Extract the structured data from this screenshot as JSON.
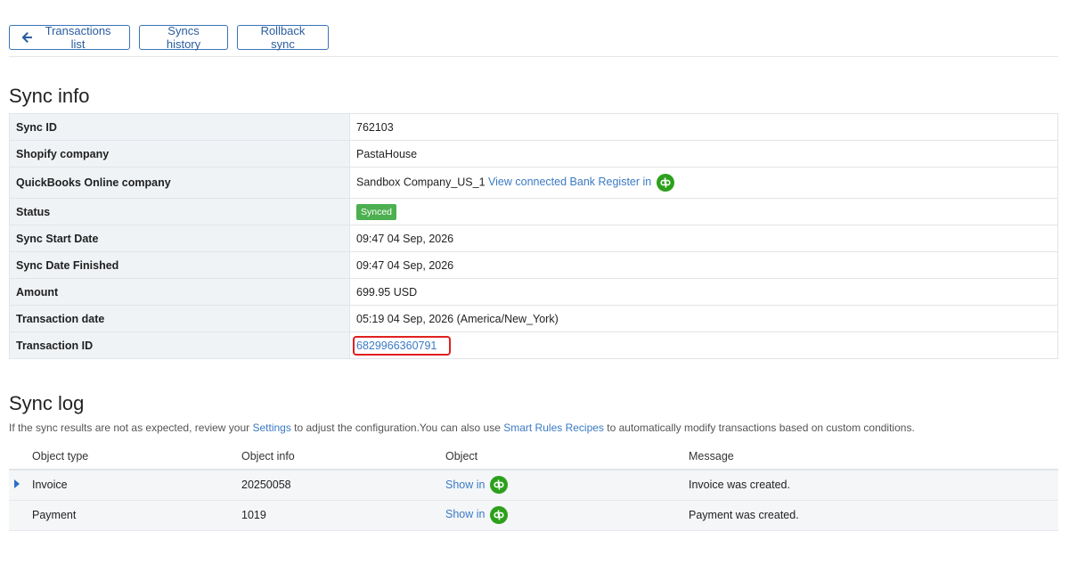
{
  "toolbar": {
    "back_label": "Transactions list",
    "history_label": "Syncs history",
    "rollback_label": "Rollback sync"
  },
  "sync_info": {
    "title": "Sync info",
    "rows": {
      "sync_id": {
        "label": "Sync ID",
        "value": "762103"
      },
      "shopify_company": {
        "label": "Shopify company",
        "value": "PastaHouse"
      },
      "qbo_company": {
        "label": "QuickBooks Online company",
        "value": "Sandbox Company_US_1",
        "link": "View connected Bank Register in"
      },
      "status": {
        "label": "Status",
        "value": "Synced"
      },
      "start_date": {
        "label": "Sync Start Date",
        "value": "09:47 04 Sep, 2026"
      },
      "finish_date": {
        "label": "Sync Date Finished",
        "value": "09:47 04 Sep, 2026"
      },
      "amount": {
        "label": "Amount",
        "value": "699.95 USD"
      },
      "transaction_date": {
        "label": "Transaction date",
        "value": "05:19 04 Sep, 2026 (America/New_York)"
      },
      "transaction_id": {
        "label": "Transaction ID",
        "value": "6829966360791"
      }
    }
  },
  "sync_log": {
    "title": "Sync log",
    "hint": {
      "part1": "If the sync results are not as expected, review your ",
      "settings_link": "Settings",
      "part2": " to adjust the configuration.You can also use ",
      "recipes_link": "Smart Rules Recipes",
      "part3": " to automatically modify transactions based on custom conditions."
    },
    "columns": {
      "type": "Object type",
      "info": "Object info",
      "object": "Object",
      "message": "Message"
    },
    "rows": [
      {
        "type": "Invoice",
        "info": "20250058",
        "object": "Show in",
        "message": "Invoice was created."
      },
      {
        "type": "Payment",
        "info": "1019",
        "object": "Show in",
        "message": "Payment was created."
      }
    ]
  },
  "colors": {
    "accent": "#3b7ac4",
    "status_green": "#4caf50",
    "qb_green": "#2ca01c",
    "highlight_red": "#e02020"
  },
  "icons": {
    "back": "arrow-left-icon",
    "quickbooks": "quickbooks-icon",
    "expand": "caret-right-icon"
  }
}
